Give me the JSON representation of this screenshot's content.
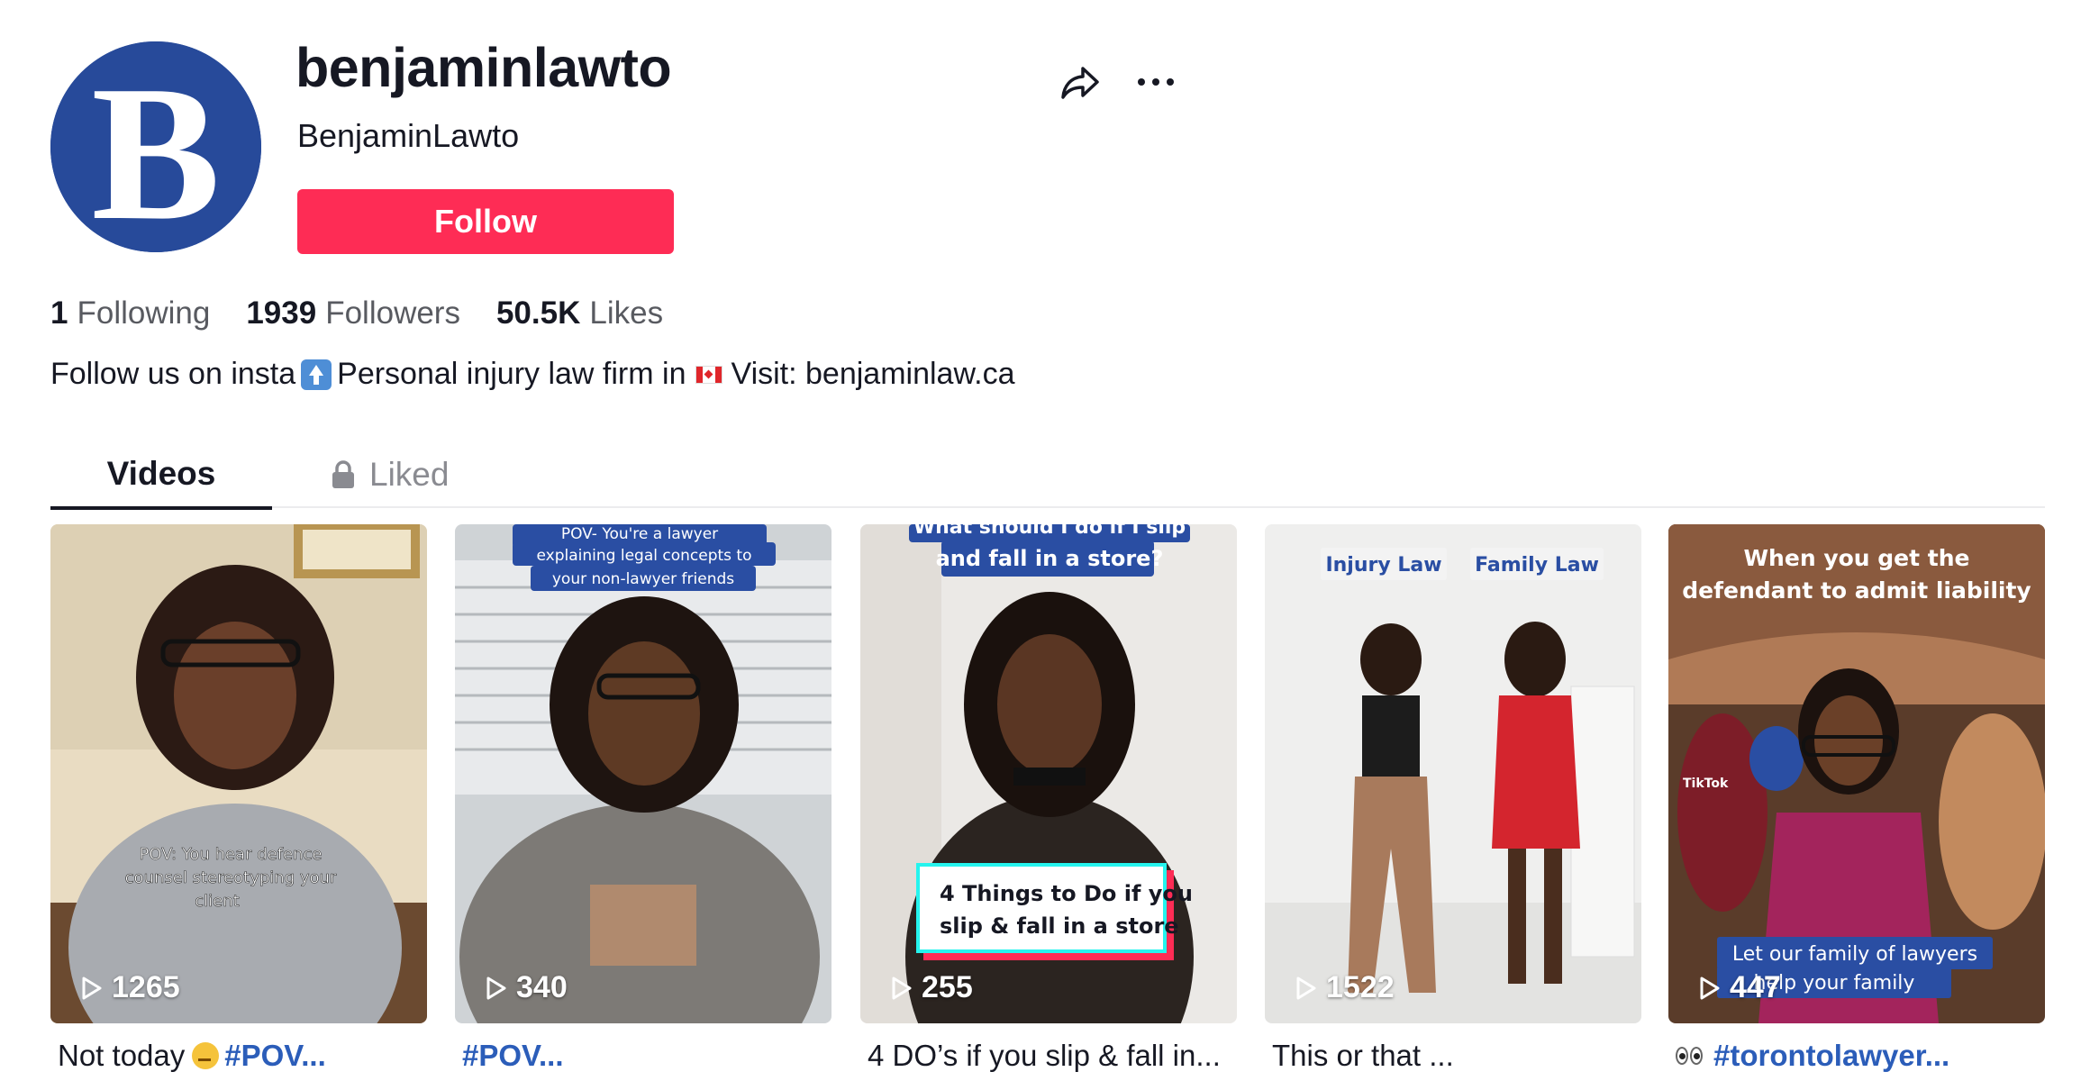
{
  "profile": {
    "username": "benjaminlawto",
    "nickname": "BenjaminLawto",
    "follow_label": "Follow",
    "avatar_letter": "B",
    "bio_part1": "Follow us on insta",
    "bio_part2": "Personal injury law firm in",
    "bio_part3": "Visit: benjaminlaw.ca"
  },
  "stats": [
    {
      "value": "1",
      "label": "Following"
    },
    {
      "value": "1939",
      "label": "Followers"
    },
    {
      "value": "50.5K",
      "label": "Likes"
    }
  ],
  "tabs": {
    "videos": "Videos",
    "liked": "Liked"
  },
  "videos": [
    {
      "views": "1265",
      "caption_text": "Not today",
      "caption_tag": "#POV...",
      "overlay": [
        "POV: You hear defence",
        "counsel stereotyping your",
        "client"
      ]
    },
    {
      "views": "340",
      "caption_text": "",
      "caption_tag": "#POV...",
      "overlay": [
        "POV- You're a lawyer",
        "explaining legal concepts to",
        "your non-lawyer friends"
      ]
    },
    {
      "views": "255",
      "caption_text": "4 DO’s if you slip & fall in...",
      "caption_tag": "",
      "overlay_top": [
        "What should I do if I slip",
        "and fall in a store?"
      ],
      "overlay_box": [
        "4 Things to Do if you",
        "slip & fall in a store"
      ]
    },
    {
      "views": "1522",
      "caption_text": "This or that ...",
      "caption_tag": "",
      "label_left": "Injury Law",
      "label_right": "Family Law"
    },
    {
      "views": "447",
      "caption_text": "",
      "caption_tag": "#torontolawyer...",
      "overlay_top": [
        "When you get the",
        "defendant to admit liability"
      ],
      "overlay_bottom": [
        "Let our family of lawyers",
        "help your family"
      ],
      "watermark": "TikTok"
    }
  ],
  "colors": {
    "follow": "#fe2c55",
    "avatar": "#274a9a",
    "hashtag": "#2b5db9"
  }
}
